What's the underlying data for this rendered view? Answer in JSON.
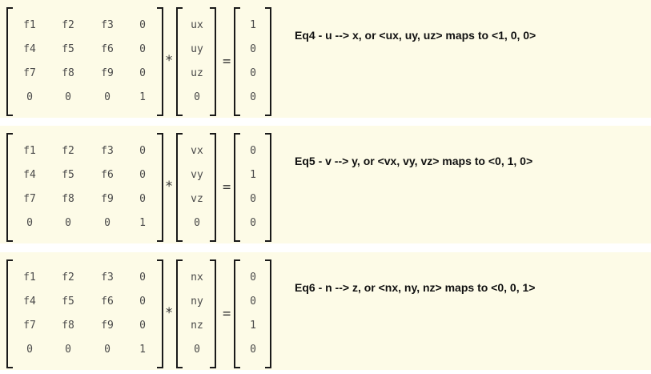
{
  "equations": [
    {
      "matrix": [
        [
          "f1",
          "f2",
          "f3",
          "0"
        ],
        [
          "f4",
          "f5",
          "f6",
          "0"
        ],
        [
          "f7",
          "f8",
          "f9",
          "0"
        ],
        [
          "0",
          "0",
          "0",
          "1"
        ]
      ],
      "operator": "*",
      "vector": [
        "ux",
        "uy",
        "uz",
        "0"
      ],
      "equals": "=",
      "result": [
        "1",
        "0",
        "0",
        "0"
      ],
      "label": "Eq4 - u --> x, or <ux, uy, uz> maps to <1, 0, 0>"
    },
    {
      "matrix": [
        [
          "f1",
          "f2",
          "f3",
          "0"
        ],
        [
          "f4",
          "f5",
          "f6",
          "0"
        ],
        [
          "f7",
          "f8",
          "f9",
          "0"
        ],
        [
          "0",
          "0",
          "0",
          "1"
        ]
      ],
      "operator": "*",
      "vector": [
        "vx",
        "vy",
        "vz",
        "0"
      ],
      "equals": "=",
      "result": [
        "0",
        "1",
        "0",
        "0"
      ],
      "label": "Eq5 - v --> y, or <vx, vy, vz> maps to <0, 1, 0>"
    },
    {
      "matrix": [
        [
          "f1",
          "f2",
          "f3",
          "0"
        ],
        [
          "f4",
          "f5",
          "f6",
          "0"
        ],
        [
          "f7",
          "f8",
          "f9",
          "0"
        ],
        [
          "0",
          "0",
          "0",
          "1"
        ]
      ],
      "operator": "*",
      "vector": [
        "nx",
        "ny",
        "nz",
        "0"
      ],
      "equals": "=",
      "result": [
        "0",
        "0",
        "1",
        "0"
      ],
      "label": "Eq6 - n --> z, or <nx, ny, nz> maps to <0, 0, 1>"
    }
  ]
}
